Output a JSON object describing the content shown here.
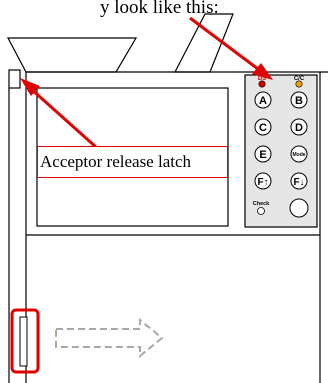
{
  "caption": "y look like this:",
  "label": "Acceptor release latch",
  "panel": {
    "indicators": {
      "left": "DS",
      "right": "C/C"
    },
    "buttons": [
      "A",
      "B",
      "C",
      "D",
      "E",
      "Mode",
      "F↑",
      "F↓"
    ],
    "check_label": "Check"
  },
  "colors": {
    "highlight": "#e00000",
    "indicator_left": "#d40000",
    "indicator_right": "#f0a000",
    "panel_bg": "#e6e6e6",
    "arrow_dash": "#a8a8a8"
  }
}
